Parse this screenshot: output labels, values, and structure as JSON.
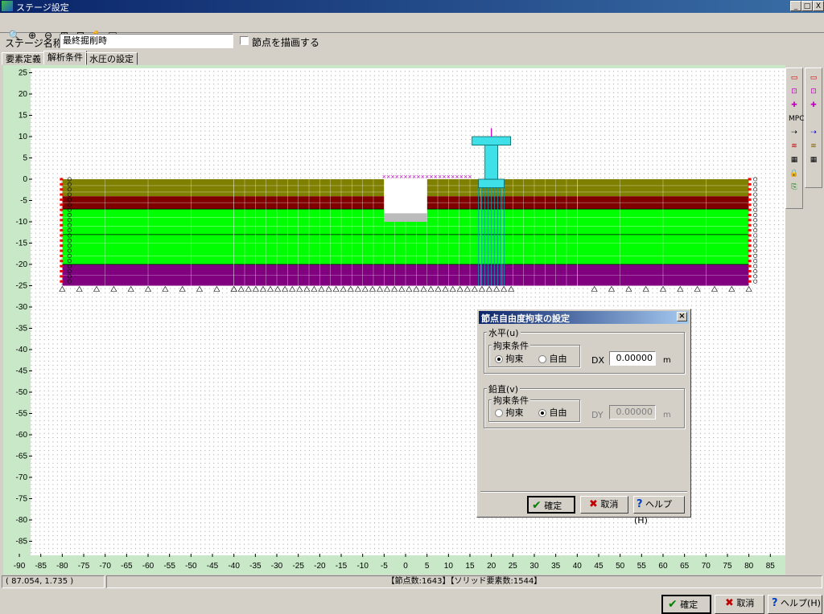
{
  "window": {
    "title": "ステージ設定",
    "controls": [
      "_",
      "□",
      "X"
    ]
  },
  "toolbar": {
    "icons": [
      "zoom-window-icon",
      "zoom-in-icon",
      "zoom-out-icon",
      "fit-all-icon",
      "fit-region-icon",
      "pan-hand-icon",
      "print-preview-icon"
    ]
  },
  "stage": {
    "name_label": "ステージ名称",
    "name_value": "最終掘削時",
    "draw_nodes_label": "節点を描画する",
    "draw_nodes_checked": false
  },
  "tabs": [
    {
      "label": "要素定義",
      "active": false
    },
    {
      "label": "解析条件",
      "active": true
    },
    {
      "label": "水圧の設定",
      "active": false
    }
  ],
  "canvas": {
    "y_ticks": [
      "25",
      "20",
      "15",
      "10",
      "5",
      "0",
      "-5",
      "-10",
      "-15",
      "-20",
      "-25",
      "-30",
      "-35",
      "-40",
      "-45",
      "-50",
      "-55",
      "-60",
      "-65",
      "-70",
      "-75",
      "-80",
      "-85"
    ],
    "x_ticks": [
      "-90",
      "-85",
      "-80",
      "-75",
      "-70",
      "-65",
      "-60",
      "-55",
      "-50",
      "-45",
      "-40",
      "-35",
      "-30",
      "-25",
      "-20",
      "-15",
      "-10",
      "-5",
      "0",
      "5",
      "10",
      "15",
      "20",
      "25",
      "30",
      "35",
      "40",
      "45",
      "50",
      "55",
      "60",
      "65",
      "70",
      "75",
      "80",
      "85"
    ],
    "layer_colors": [
      "#7f7f00",
      "#800000",
      "#00ff00",
      "#00ff00",
      "#800080"
    ],
    "structure_color": "#40e0e8"
  },
  "palette_right1": [
    {
      "icon": "rect-select-icon",
      "text": ""
    },
    {
      "icon": "node-select-icon",
      "text": ""
    },
    {
      "icon": "fix-node-icon",
      "text": ""
    },
    {
      "icon": "mpc-icon",
      "text": "MPC"
    },
    {
      "icon": "arrow-link-icon",
      "text": ""
    },
    {
      "icon": "spring-icon",
      "text": ""
    },
    {
      "icon": "table-icon",
      "text": ""
    },
    {
      "icon": "lock-icon",
      "text": ""
    },
    {
      "icon": "copy-icon",
      "text": ""
    }
  ],
  "palette_right2": [
    {
      "icon": "rect-select-icon",
      "text": ""
    },
    {
      "icon": "node-select-icon",
      "text": ""
    },
    {
      "icon": "element-select-icon",
      "text": ""
    },
    {
      "icon": "number-table-icon",
      "text": ""
    },
    {
      "icon": "number-table-icon",
      "text": ""
    },
    {
      "icon": "lock-icon",
      "text": ""
    },
    {
      "icon": "export-icon",
      "text": ""
    }
  ],
  "dialog": {
    "title": "節点自由度拘束の設定",
    "close": "×",
    "horizontal": {
      "group_label": "水平(u)",
      "cond_label": "拘束条件",
      "opt_fixed": "拘束",
      "opt_free": "自由",
      "selected": "fixed",
      "field_label": "DX",
      "value": "0.00000",
      "unit": "m"
    },
    "vertical": {
      "group_label": "鉛直(v)",
      "cond_label": "拘束条件",
      "opt_fixed": "拘束",
      "opt_free": "自由",
      "selected": "free",
      "field_label": "DY",
      "value": "0.00000",
      "unit": "m"
    },
    "ok_label": "確定",
    "cancel_label": "取消",
    "help_label": "ヘルプ(H)"
  },
  "status": {
    "coords": "(  87.054,    1.735 )",
    "counts": "【節点数:1643】【ソリッド要素数:1544】"
  },
  "footer": {
    "ok_label": "確定",
    "cancel_label": "取消",
    "help_label": "ヘルプ(H)"
  },
  "colors": {
    "ruler_bg": "#c8e8c8",
    "ok_check": "#008000",
    "cancel_x": "#c00000",
    "help_q": "#0040c0"
  }
}
